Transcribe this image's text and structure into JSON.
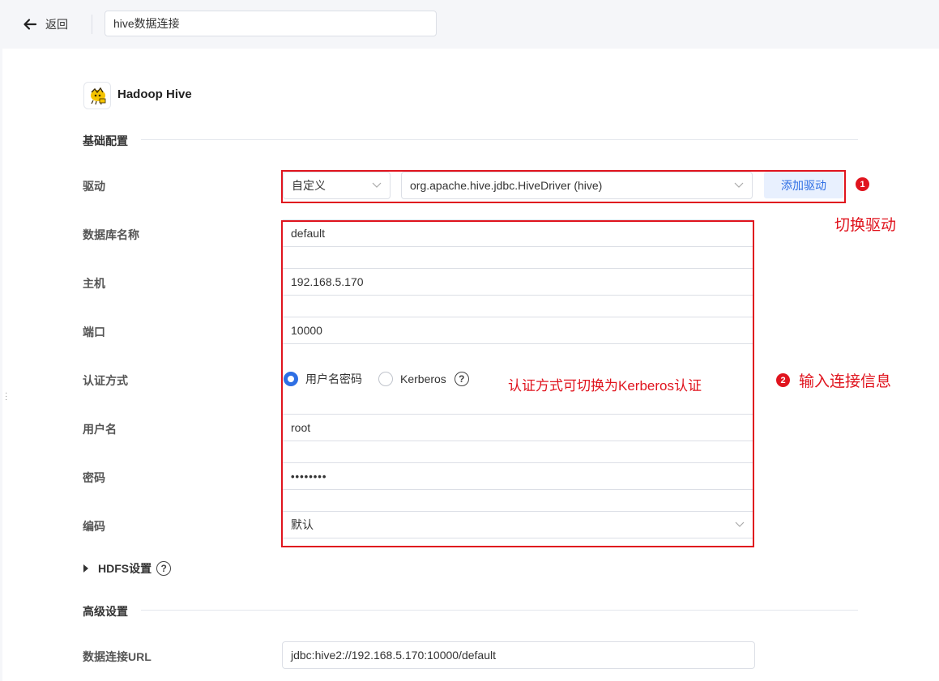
{
  "header": {
    "back_label": "返回",
    "title_value": "hive数据连接"
  },
  "datasource": {
    "name": "Hadoop Hive"
  },
  "sections": {
    "basic": "基础配置",
    "advanced": "高级设置",
    "hdfs": "HDFS设置"
  },
  "form": {
    "driver": {
      "label": "驱动",
      "type_value": "自定义",
      "driver_value": "org.apache.hive.jdbc.HiveDriver (hive)",
      "add_button": "添加驱动"
    },
    "database": {
      "label": "数据库名称",
      "value": "default"
    },
    "host": {
      "label": "主机",
      "value": "192.168.5.170"
    },
    "port": {
      "label": "端口",
      "value": "10000"
    },
    "auth": {
      "label": "认证方式",
      "options": [
        "用户名密码",
        "Kerberos"
      ],
      "selected": "用户名密码"
    },
    "username": {
      "label": "用户名",
      "value": "root"
    },
    "password": {
      "label": "密码",
      "value": "••••••••"
    },
    "encoding": {
      "label": "编码",
      "value": "默认"
    },
    "url": {
      "label": "数据连接URL",
      "value": "jdbc:hive2://192.168.5.170:10000/default"
    }
  },
  "annotations": {
    "n1": "1",
    "n2": "2",
    "switch_driver": "切换驱动",
    "input_info": "输入连接信息",
    "auth_note": "认证方式可切换为Kerberos认证",
    "color": "#e0141e"
  },
  "colors": {
    "accent": "#2f6fe4",
    "topbar_bg": "#f5f6f9"
  }
}
